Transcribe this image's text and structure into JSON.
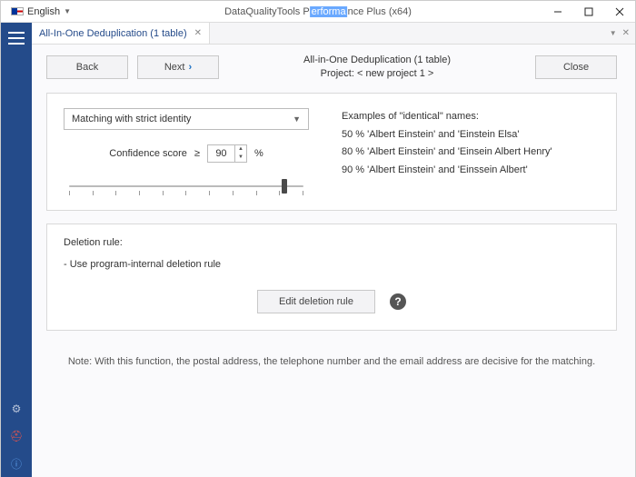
{
  "window": {
    "language": "English",
    "title_prefix": "DataQualityTools P",
    "title_highlight": "erforma",
    "title_suffix": "nce Plus (x64)"
  },
  "tab": {
    "label": "All-In-One Deduplication (1 table)"
  },
  "nav": {
    "back": "Back",
    "next": "Next",
    "close": "Close",
    "heading": "All-in-One Deduplication (1 table)",
    "subheading": "Project: < new project 1 >"
  },
  "match": {
    "mode": "Matching with strict identity",
    "confidence_label": "Confidence score",
    "ge": "≥",
    "value": "90",
    "pct": "%",
    "slider_percent": 90
  },
  "examples": {
    "title": "Examples of \"identical\" names:",
    "rows": [
      "50 %   'Albert Einstein' and 'Einstein Elsa'",
      "80 %   'Albert Einstein' and 'Einsein Albert Henry'",
      "90 %   'Albert Einstein' and 'Einssein Albert'"
    ]
  },
  "deletion": {
    "title": "Deletion rule:",
    "rule": "- Use program-internal deletion rule",
    "edit": "Edit deletion rule"
  },
  "note": "Note: With this function, the postal address, the telephone number and the email address are decisive for the matching."
}
